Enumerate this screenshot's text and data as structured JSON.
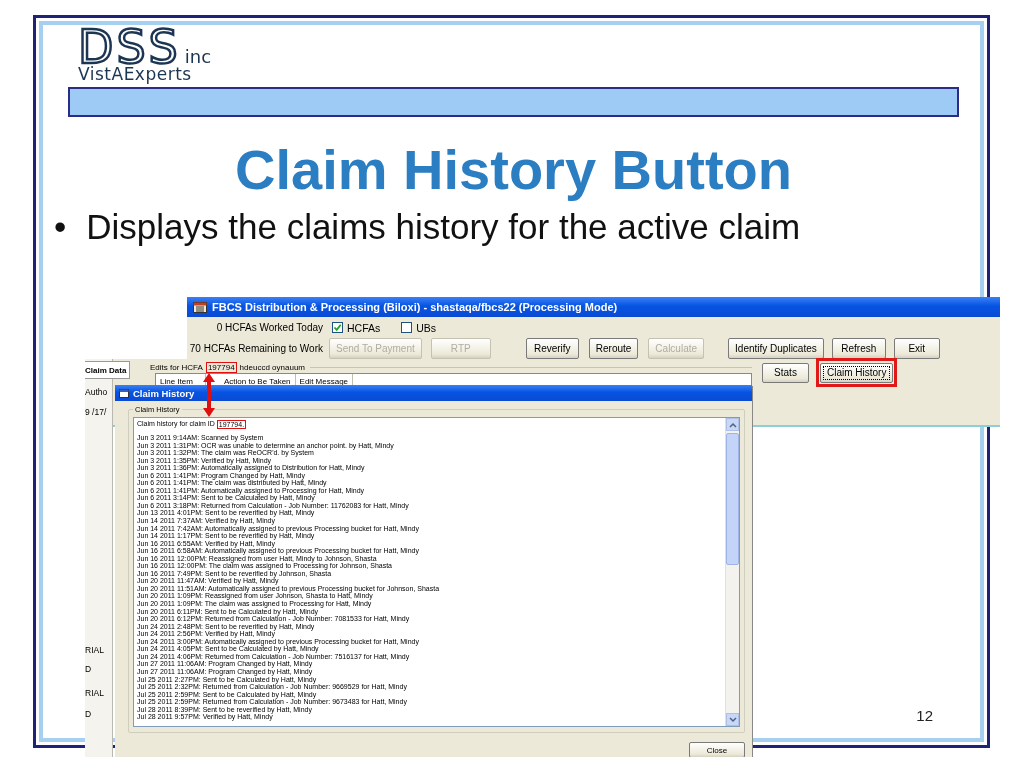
{
  "slide": {
    "logo": {
      "mark": "DSS",
      "suffix": "inc",
      "tagline": "VistAExperts"
    },
    "title": "Claim History Button",
    "bullets": [
      {
        "marker": "•",
        "text": "Displays the claims history for the active claim"
      }
    ],
    "page_number": "12"
  },
  "main_window": {
    "title": "FBCS Distribution & Processing (Biloxi) - shastaqa/fbcs22 (Processing Mode)",
    "worked_today": "0 HCFAs Worked Today",
    "remaining": "70 HCFAs Remaining to Work",
    "filters": [
      {
        "label": "HCFAs",
        "checked": true
      },
      {
        "label": "UBs",
        "checked": false
      }
    ],
    "buttons": [
      {
        "label": "Send To Payment",
        "disabled": true
      },
      {
        "label": "RTP",
        "disabled": true
      },
      {
        "label": "Reverify",
        "disabled": false
      },
      {
        "label": "Reroute",
        "disabled": false
      },
      {
        "label": "Calculate",
        "disabled": true
      },
      {
        "label": "Identify Duplicates",
        "disabled": false
      },
      {
        "label": "Refresh",
        "disabled": false
      },
      {
        "label": "Exit",
        "disabled": false
      }
    ],
    "side_buttons": [
      {
        "label": "Stats",
        "highlighted": false
      },
      {
        "label": "Claim History",
        "highlighted": true
      }
    ],
    "left_pane": {
      "tab": "Claim Data",
      "texts": [
        "Autho",
        "9 /17/",
        "RIAL",
        "D",
        "RIAL",
        "D"
      ]
    },
    "edits": {
      "label": "Edits for HCFA",
      "claim_id": "197794",
      "name": "hdeuccd oynauum",
      "columns": [
        "Line Item",
        "Action to Be Taken",
        "Edit Message"
      ]
    }
  },
  "dialog": {
    "title": "Claim History",
    "group": "Claim History",
    "intro": "Claim history for claim ID",
    "claim_id": "197794.",
    "entries": [
      "Jun 3 2011 9:14AM: Scanned by System",
      "Jun 3 2011 1:31PM: OCR was unable to determine an anchor point. by Hatt, Mindy",
      "Jun 3 2011 1:32PM: The claim was ReOCR'd. by System",
      "Jun 3 2011 1:35PM: Verified by Hatt, Mindy",
      "Jun 3 2011 1:36PM: Automatically assigned to Distribution for Hatt, Mindy",
      "Jun 6 2011 1:41PM: Program Changed by Hatt, Mindy",
      "Jun 6 2011 1:41PM: The claim was distributed by Hatt, Mindy",
      "Jun 6 2011 1:41PM: Automatically assigned to Processing for Hatt, Mindy",
      "Jun 6 2011 3:14PM: Sent to be Calculated by Hatt, Mindy",
      "Jun 6 2011 3:18PM: Returned from Calculation - Job Number: 11762083 for Hatt, Mindy",
      "Jun 13 2011 4:01PM: Sent to be reverified by Hatt, Mindy",
      "Jun 14 2011 7:37AM: Verified by Hatt, Mindy",
      "Jun 14 2011 7:42AM: Automatically assigned to previous Processing bucket for Hatt, Mindy",
      "Jun 14 2011 1:17PM: Sent to be reverified by Hatt, Mindy",
      "Jun 16 2011 6:55AM: Verified by Hatt, Mindy",
      "Jun 16 2011 6:58AM: Automatically assigned to previous Processing bucket for Hatt, Mindy",
      "Jun 16 2011 12:00PM: Reassigned from user Hatt, Mindy to Johnson, Shasta",
      "Jun 16 2011 12:00PM: The claim was assigned to Processing for Johnson, Shasta",
      "Jun 16 2011 7:49PM: Sent to be reverified by Johnson, Shasta",
      "Jun 20 2011 11:47AM: Verified by Hatt, Mindy",
      "Jun 20 2011 11:51AM: Automatically assigned to previous Processing bucket for Johnson, Shasta",
      "Jun 20 2011 1:09PM: Reassigned from user Johnson, Shasta to Hatt, Mindy",
      "Jun 20 2011 1:09PM: The claim was assigned to Processing for Hatt, Mindy",
      "Jun 20 2011 6:11PM: Sent to be Calculated by Hatt, Mindy",
      "Jun 20 2011 6:12PM: Returned from Calculation - Job Number: 7081533 for Hatt, Mindy",
      "Jun 24 2011 2:48PM: Sent to be reverified by Hatt, Mindy",
      "Jun 24 2011 2:56PM: Verified by Hatt, Mindy",
      "Jun 24 2011 3:00PM: Automatically assigned to previous Processing bucket for Hatt, Mindy",
      "Jun 24 2011 4:05PM: Sent to be Calculated by Hatt, Mindy",
      "Jun 24 2011 4:06PM: Returned from Calculation - Job Number: 7516137 for Hatt, Mindy",
      "Jun 27 2011 11:06AM: Program Changed by Hatt, Mindy",
      "Jun 27 2011 11:06AM: Program Changed by Hatt, Mindy",
      "Jul 25 2011 2:27PM: Sent to be Calculated by Hatt, Mindy",
      "Jul 25 2011 2:32PM: Returned from Calculation - Job Number: 9669529 for Hatt, Mindy",
      "Jul 25 2011 2:59PM: Sent to be Calculated by Hatt, Mindy",
      "Jul 25 2011 2:59PM: Returned from Calculation - Job Number: 9673483 for Hatt, Mindy",
      "Jul 28 2011 8:39PM: Sent to be reverified by Hatt, Mindy",
      "Jul 28 2011 9:57PM: Verified by Hatt, Mindy"
    ],
    "close": "Close"
  }
}
